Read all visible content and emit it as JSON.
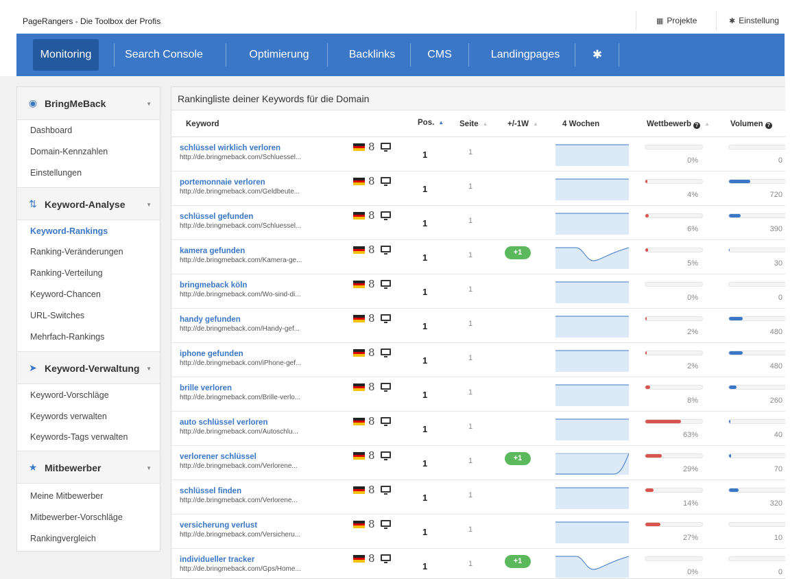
{
  "app": {
    "brand": "PageRangers - Die Toolbox der Profis",
    "top_buttons": [
      {
        "label": "Projekte",
        "icon": "table-icon"
      },
      {
        "label": "Einstellung",
        "icon": "gear-icon"
      }
    ]
  },
  "nav": {
    "items": [
      "Monitoring",
      "Search Console",
      "Optimierung",
      "Backlinks",
      "CMS",
      "Landingpages"
    ],
    "active": "Monitoring",
    "settings_icon": "gear-icon"
  },
  "sidebar": {
    "sections": [
      {
        "title": "BringMeBack",
        "icon": "dashboard-icon",
        "items": [
          "Dashboard",
          "Domain-Kennzahlen",
          "Einstellungen"
        ]
      },
      {
        "title": "Keyword-Analyse",
        "icon": "sort-icon",
        "items": [
          "Keyword-Rankings",
          "Ranking-Veränderungen",
          "Ranking-Verteilung",
          "Keyword-Chancen",
          "URL-Switches",
          "Mehrfach-Rankings"
        ]
      },
      {
        "title": "Keyword-Verwaltung",
        "icon": "tags-icon",
        "items": [
          "Keyword-Vorschläge",
          "Keywords verwalten",
          "Keywords-Tags verwalten"
        ]
      },
      {
        "title": "Mitbewerber",
        "icon": "trophy-icon",
        "items": [
          "Meine Mitbewerber",
          "Mitbewerber-Vorschläge",
          "Rankingvergleich"
        ]
      }
    ],
    "active_item": "Keyword-Rankings"
  },
  "main": {
    "title": "Rankingliste deiner Keywords für die Domain",
    "columns": [
      "Keyword",
      "Pos.",
      "Seite",
      "+/-1W",
      "4 Wochen",
      "Wettbewerb",
      "Volumen"
    ],
    "sort_column": "Pos.",
    "rows": [
      {
        "keyword": "schlüssel wirklich verloren",
        "url": "http://de.bringmeback.com/Schluessel...",
        "pos": "1",
        "seite": "1",
        "change": "",
        "trend": "flat",
        "wettbewerb": 0,
        "wettbewerb_label": "0%",
        "volumen": 0,
        "volumen_label": "0"
      },
      {
        "keyword": "portemonnaie verloren",
        "url": "http://de.bringmeback.com/Geldbeute...",
        "pos": "1",
        "seite": "1",
        "change": "",
        "trend": "flat",
        "wettbewerb": 4,
        "wettbewerb_label": "4%",
        "volumen": 720,
        "volumen_label": "720"
      },
      {
        "keyword": "schlüssel gefunden",
        "url": "http://de.bringmeback.com/Schluessel...",
        "pos": "1",
        "seite": "1",
        "change": "",
        "trend": "flat",
        "wettbewerb": 6,
        "wettbewerb_label": "6%",
        "volumen": 390,
        "volumen_label": "390"
      },
      {
        "keyword": "kamera gefunden",
        "url": "http://de.bringmeback.com/Kamera-ge...",
        "pos": "1",
        "seite": "1",
        "change": "+1",
        "trend": "dip",
        "wettbewerb": 5,
        "wettbewerb_label": "5%",
        "volumen": 30,
        "volumen_label": "30"
      },
      {
        "keyword": "bringmeback köln",
        "url": "http://de.bringmeback.com/Wo-sind-di...",
        "pos": "1",
        "seite": "1",
        "change": "",
        "trend": "flat",
        "wettbewerb": 0,
        "wettbewerb_label": "0%",
        "volumen": 0,
        "volumen_label": "0"
      },
      {
        "keyword": "handy gefunden",
        "url": "http://de.bringmeback.com/Handy-gef...",
        "pos": "1",
        "seite": "1",
        "change": "",
        "trend": "flat",
        "wettbewerb": 2,
        "wettbewerb_label": "2%",
        "volumen": 480,
        "volumen_label": "480"
      },
      {
        "keyword": "iphone gefunden",
        "url": "http://de.bringmeback.com/iPhone-gef...",
        "pos": "1",
        "seite": "1",
        "change": "",
        "trend": "flat",
        "wettbewerb": 2,
        "wettbewerb_label": "2%",
        "volumen": 480,
        "volumen_label": "480"
      },
      {
        "keyword": "brille verloren",
        "url": "http://de.bringmeback.com/Brille-verlo...",
        "pos": "1",
        "seite": "1",
        "change": "",
        "trend": "flat",
        "wettbewerb": 8,
        "wettbewerb_label": "8%",
        "volumen": 260,
        "volumen_label": "260"
      },
      {
        "keyword": "auto schlüssel verloren",
        "url": "http://de.bringmeback.com/Autoschlu...",
        "pos": "1",
        "seite": "1",
        "change": "",
        "trend": "flat",
        "wettbewerb": 63,
        "wettbewerb_label": "63%",
        "volumen": 40,
        "volumen_label": "40"
      },
      {
        "keyword": "verlorener schlüssel",
        "url": "http://de.bringmeback.com/Verlorene...",
        "pos": "1",
        "seite": "1",
        "change": "+1",
        "trend": "rise",
        "wettbewerb": 29,
        "wettbewerb_label": "29%",
        "volumen": 70,
        "volumen_label": "70"
      },
      {
        "keyword": "schlüssel finden",
        "url": "http://de.bringmeback.com/Verlorene...",
        "pos": "1",
        "seite": "1",
        "change": "",
        "trend": "flat",
        "wettbewerb": 14,
        "wettbewerb_label": "14%",
        "volumen": 320,
        "volumen_label": "320"
      },
      {
        "keyword": "versicherung verlust",
        "url": "http://de.bringmeback.com/Versicheru...",
        "pos": "1",
        "seite": "1",
        "change": "",
        "trend": "flat",
        "wettbewerb": 27,
        "wettbewerb_label": "27%",
        "volumen": 10,
        "volumen_label": "10"
      },
      {
        "keyword": "individueller tracker",
        "url": "http://de.bringmeback.com/Gps/Home...",
        "pos": "1",
        "seite": "1",
        "change": "+1",
        "trend": "dip",
        "wettbewerb": 0,
        "wettbewerb_label": "0%",
        "volumen": 0,
        "volumen_label": "0"
      }
    ]
  },
  "colors": {
    "nav": "#3a77c6",
    "nav_active": "#235a9f",
    "link": "#3a77c6",
    "badge": "#5cb85c",
    "wettbewerb_bar": "#d9534f",
    "volumen_bar": "#3a77c6",
    "spark_fill": "#dce9f7",
    "spark_line": "#3a77c6"
  }
}
